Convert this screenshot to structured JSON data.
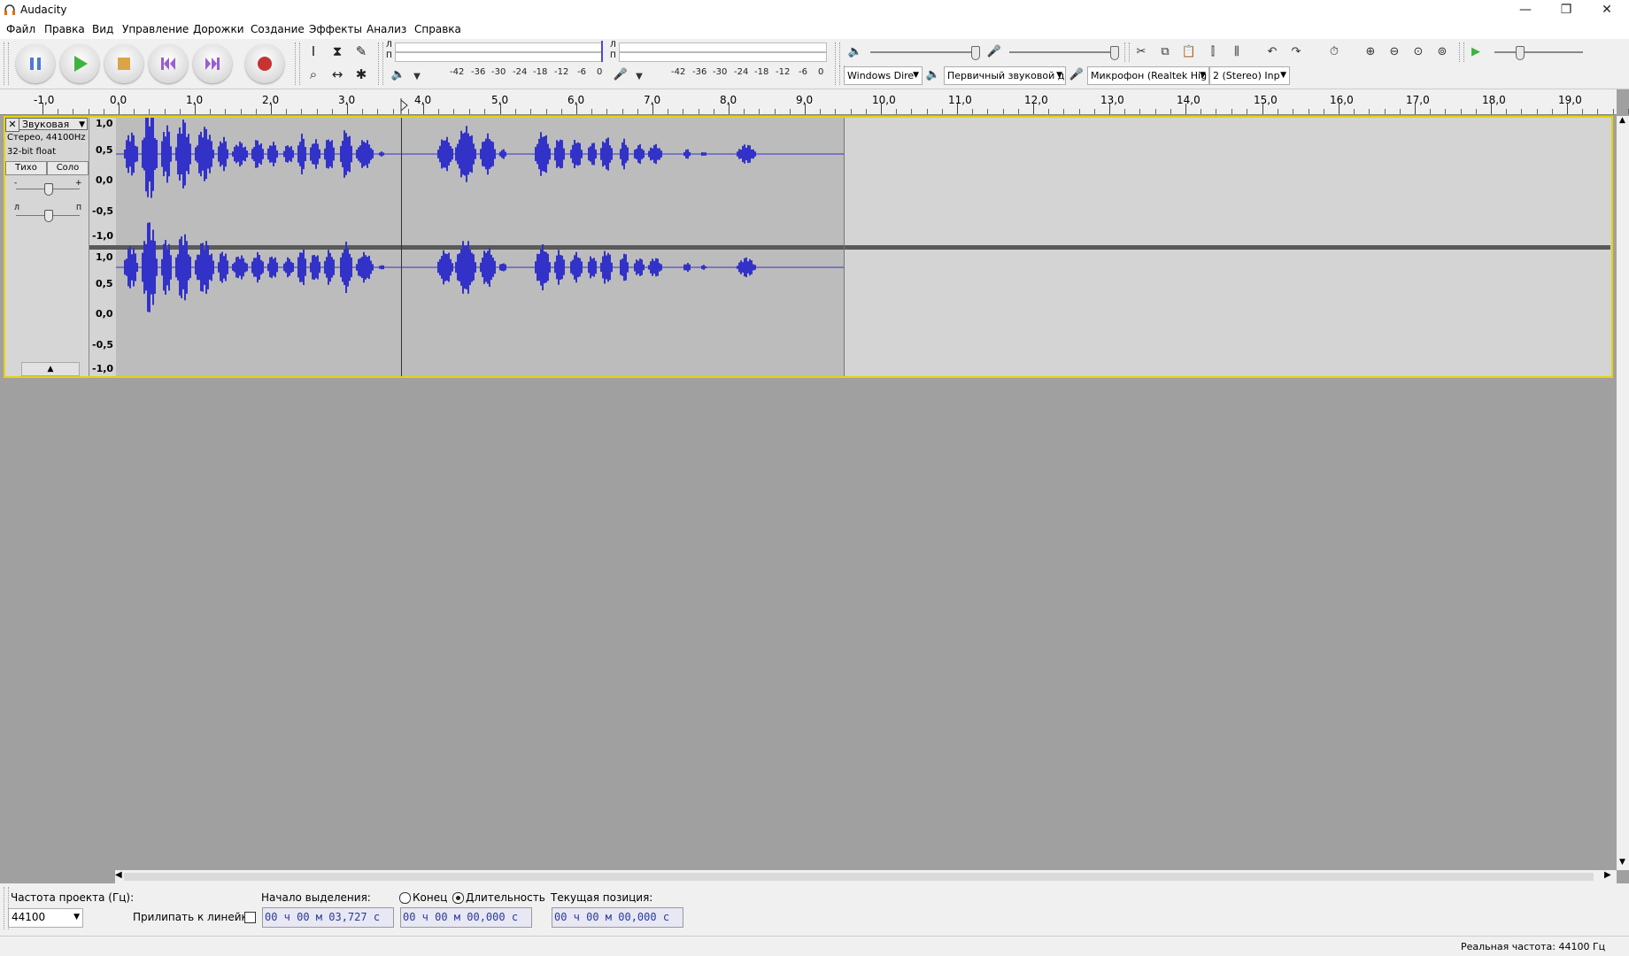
{
  "window": {
    "title": "Audacity",
    "minimize": "—",
    "restore": "❐",
    "close": "✕"
  },
  "menu": [
    "Файл",
    "Правка",
    "Вид",
    "Управление",
    "Дорожки",
    "Создание",
    "Эффекты",
    "Анализ",
    "Справка"
  ],
  "meters": {
    "playback_scale": [
      "-42",
      "-36",
      "-30",
      "-24",
      "-18",
      "-12",
      "-6",
      "0"
    ],
    "record_scale": [
      "-42",
      "-36",
      "-30",
      "-24",
      "-18",
      "-12",
      "-6",
      "0"
    ],
    "left_label": "Л",
    "right_label": "П"
  },
  "devices": {
    "host": "Windows Dire",
    "output": "Первичный звуковой д",
    "input": "Микрофон (Realtek Hig",
    "channels": "2 (Stereo) Inp"
  },
  "ruler": {
    "labels": [
      "-1,0",
      "0,0",
      "1,0",
      "2,0",
      "3,0",
      "4,0",
      "5,0",
      "6,0",
      "7,0",
      "8,0",
      "9,0",
      "10,0",
      "11,0",
      "12,0",
      "13,0",
      "14,0",
      "15,0",
      "16,0",
      "17,0",
      "18,0",
      "19,0"
    ]
  },
  "track": {
    "name": "Звуковая",
    "info_line1": "Стерео, 44100Hz",
    "info_line2": "32-bit float",
    "mute": "Тихо",
    "solo": "Соло",
    "gain_minus": "-",
    "gain_plus": "+",
    "pan_left": "Л",
    "pan_right": "П",
    "collapse": "▲",
    "scale": [
      "1,0",
      "0,5",
      "0,0",
      "-0,5",
      "-1,0"
    ]
  },
  "status": {
    "rate_label": "Частота проекта (Гц):",
    "rate_value": "44100",
    "snap_label": "Прилипать к линейке",
    "sel_start_label": "Начало выделения:",
    "end_label": "Конец",
    "length_label": "Длительность",
    "position_label": "Текущая позиция:",
    "sel_start": "00 ч 00 м 03,727 с",
    "sel_length": "00 ч 00 м 00,000 с",
    "position": "00 ч 00 м 00,000 с",
    "actual_rate": "Реальная частота: 44100 Гц"
  },
  "colors": {
    "waveform": "#3232c8",
    "clip": "#bcbcbc",
    "selection_border": "#e6d400"
  }
}
